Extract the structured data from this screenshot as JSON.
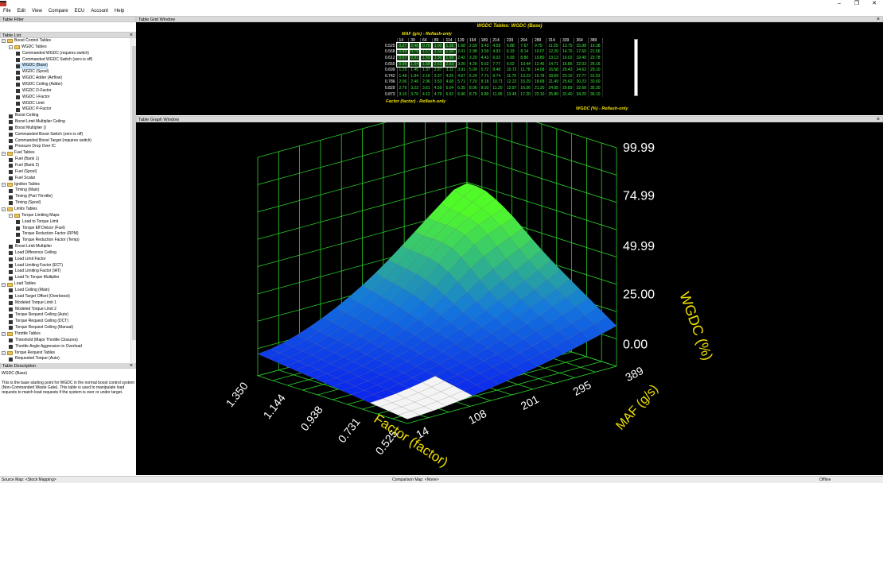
{
  "menu": [
    "File",
    "Edit",
    "View",
    "Compare",
    "ECU",
    "Account",
    "Help"
  ],
  "window_controls": [
    "–",
    "❐",
    "✕"
  ],
  "left": {
    "filter_title": "Table Filter",
    "list_title": "Table List",
    "desc_title": "Table Description",
    "desc_name": "WGDC (Base)",
    "desc_text": "This is the base starting point for WGDC in the normal boost control system (Non-Commanded Waste Gate). This table is used to manipulate load requests to match load requests if the system is over or under target."
  },
  "tree": [
    {
      "label": "Boost Control Tables",
      "level": 0,
      "folder": true
    },
    {
      "label": "WGDC Tables",
      "level": 1,
      "folder": true
    },
    {
      "label": "Commanded WGDC (requires switch)",
      "level": 2
    },
    {
      "label": "Commanded WGDC Switch (zero is off)",
      "level": 2
    },
    {
      "label": "WGDC (Base)",
      "level": 2
    },
    {
      "label": "WGDC (Spool)",
      "level": 2
    },
    {
      "label": "WGDC Adder (Airflow)",
      "level": 2
    },
    {
      "label": "WGDC Ceiling (Adder)",
      "level": 2
    },
    {
      "label": "WGDC D-Factor",
      "level": 2
    },
    {
      "label": "WGDC I-Factor",
      "level": 2
    },
    {
      "label": "WGDC Limit",
      "level": 2
    },
    {
      "label": "WGDC P-Factor",
      "level": 2
    },
    {
      "label": "Boost Ceiling",
      "level": 1
    },
    {
      "label": "Boost Limit Multiplier Ceiling",
      "level": 1
    },
    {
      "label": "Boost Multiplier ()",
      "level": 1
    },
    {
      "label": "Commanded Boost Switch (zero is off)",
      "level": 1
    },
    {
      "label": "Commanded Boost Target (requires switch)",
      "level": 1
    },
    {
      "label": "Pressure Drop Over IC",
      "level": 1
    },
    {
      "label": "Fuel Tables",
      "level": 0,
      "folder": true
    },
    {
      "label": "Fuel (Bank 1)",
      "level": 1
    },
    {
      "label": "Fuel (Bank 2)",
      "level": 1
    },
    {
      "label": "Fuel (Spool)",
      "level": 1
    },
    {
      "label": "Fuel Scalar",
      "level": 1
    },
    {
      "label": "Ignition Tables",
      "level": 0,
      "folder": true
    },
    {
      "label": "Timing (Main)",
      "level": 1
    },
    {
      "label": "Timing (Part Throttle)",
      "level": 1
    },
    {
      "label": "Timing (Spool)",
      "level": 1
    },
    {
      "label": "Limits Tables",
      "level": 0,
      "folder": true
    },
    {
      "label": "Torque Limiting Maps",
      "level": 1,
      "folder": true
    },
    {
      "label": "Load to Torque Limit",
      "level": 2
    },
    {
      "label": "Torque Eff Divisor (Fuel)",
      "level": 2
    },
    {
      "label": "Torque Reduction Factor (RPM)",
      "level": 2
    },
    {
      "label": "Torque Reduction Factor (Temp)",
      "level": 2
    },
    {
      "label": "Boost Limit Multiplier",
      "level": 1
    },
    {
      "label": "Load Difference Ceiling",
      "level": 1
    },
    {
      "label": "Load Limit Factor",
      "level": 1
    },
    {
      "label": "Load Limiting Factor (ECT)",
      "level": 1
    },
    {
      "label": "Load Limiting Factor (IAT)",
      "level": 1
    },
    {
      "label": "Load To Torque Multiplier",
      "level": 1
    },
    {
      "label": "Load Tables",
      "level": 0,
      "folder": true
    },
    {
      "label": "Load Ceiling (Main)",
      "level": 1
    },
    {
      "label": "Load Target Offset (Overboost)",
      "level": 1
    },
    {
      "label": "Modeled Torque Limit 1",
      "level": 1
    },
    {
      "label": "Modeled Torque Limit 2",
      "level": 1
    },
    {
      "label": "Torque Request Ceiling (Auto)",
      "level": 1
    },
    {
      "label": "Torque Request Ceiling (DCT)",
      "level": 1
    },
    {
      "label": "Torque Request Ceiling (Manual)",
      "level": 1
    },
    {
      "label": "Throttle Tables",
      "level": 0,
      "folder": true
    },
    {
      "label": "Threshold (Major Throttle Closures)",
      "level": 1
    },
    {
      "label": "Throttle Angle Aggression in Overload",
      "level": 1
    },
    {
      "label": "Torque Request Tables",
      "level": 0,
      "folder": true
    },
    {
      "label": "Requested Torque (Auto)",
      "level": 1
    }
  ],
  "grid": {
    "window_title": "Table Grid Window",
    "table_title": "WGDC Tables: WGDC (Base)",
    "x_axis_label": "MAF (g/s) - Reflash-only",
    "y_axis_label": "Factor (factor) - Reflash-only",
    "value_label": "WGDC (%) - Reflash-only",
    "columns": [
      "14",
      "39",
      "64",
      "89",
      "114",
      "139",
      "164",
      "189",
      "214",
      "239",
      "264",
      "289",
      "314",
      "339",
      "364",
      "389"
    ],
    "rows": [
      {
        "h": "0.525",
        "v": [
          "0.27",
          "2.48",
          "0.78",
          "1.00",
          "1.38",
          "1.68",
          "2.59",
          "3.43",
          "4.59",
          "5.88",
          "7.67",
          "9.75",
          "11.55",
          "13.75",
          "15.98",
          "19.38"
        ]
      },
      {
        "h": "0.568",
        "v": [
          "0.49",
          "0.79",
          "1.17",
          "1.33",
          "1.54",
          "2.01",
          "2.98",
          "3.59",
          "4.93",
          "6.33",
          "8.14",
          "10.07",
          "12.20",
          "14.76",
          "17.60",
          "21.56"
        ]
      },
      {
        "h": "0.612",
        "v": [
          "0.67",
          "0.91",
          "1.59",
          "1.90",
          "1.98",
          "2.42",
          "3.29",
          "4.43",
          "6.02",
          "6.99",
          "8.80",
          "10.80",
          "13.13",
          "16.02",
          "19.40",
          "23.78"
        ]
      },
      {
        "h": "0.655",
        "v": [
          "0.95",
          "1.34",
          "1.68",
          "2.63",
          "2.53",
          "3.26",
          "4.26",
          "5.62",
          "7.77",
          "9.02",
          "10.44",
          "12.46",
          "14.71",
          "16.86",
          "22.03",
          "26.16"
        ]
      },
      {
        "h": "0.699",
        "v": [
          "1.29",
          "1.46",
          "1.97",
          "2.87",
          "3.11",
          "3.91",
          "5.09",
          "5.72",
          "8.48",
          "10.72",
          "11.78",
          "14.08",
          "16.58",
          "20.43",
          "24.62",
          "29.10"
        ]
      },
      {
        "h": "0.742",
        "v": [
          "1.48",
          "1.84",
          "2.16",
          "3.37",
          "4.25",
          "4.67",
          "6.24",
          "7.71",
          "9.74",
          "11.76",
          "13.23",
          "15.78",
          "18.69",
          "23.10",
          "27.77",
          "31.52"
        ]
      },
      {
        "h": "0.786",
        "v": [
          "2.06",
          "2.46",
          "2.96",
          "3.53",
          "4.68",
          "5.71",
          "7.20",
          "8.18",
          "10.71",
          "12.22",
          "15.29",
          "18.68",
          "21.49",
          "25.62",
          "30.23",
          "33.60"
        ]
      },
      {
        "h": "0.829",
        "v": [
          "2.79",
          "3.23",
          "3.61",
          "4.59",
          "5.04",
          "6.35",
          "8.06",
          "8.93",
          "11.20",
          "12.87",
          "16.56",
          "21.20",
          "24.95",
          "29.89",
          "32.68",
          "35.30"
        ]
      },
      {
        "h": "0.873",
        "v": [
          "3.10",
          "3.70",
          "4.12",
          "4.79",
          "5.52",
          "6.96",
          "8.75",
          "9.80",
          "11.95",
          "13.45",
          "17.20",
          "22.10",
          "25.80",
          "31.40",
          "34.20",
          "36.10"
        ]
      }
    ]
  },
  "graph": {
    "window_title": "Table Graph Window",
    "z_label": "WGDC (%)",
    "x_label": "Factor (factor)",
    "y_label": "MAF (g/s)",
    "z_ticks": [
      "99.99",
      "74.99",
      "49.99",
      "25.00",
      "0.00"
    ],
    "x_ticks": [
      "0.525",
      "0.731",
      "0.938",
      "1.144",
      "1.350"
    ],
    "y_ticks": [
      "389",
      "295",
      "201",
      "108",
      "14"
    ],
    "colors": {
      "grid": "#2bd12b",
      "axis_label": "#f0e000",
      "tick": "#ffffff",
      "surface_low": "#1a1aff",
      "surface_high": "#44ff22"
    }
  },
  "status": {
    "source": "Source Map: <Stock Mapping>",
    "comparison": "Comparison Map: <None>",
    "state": "Offline"
  }
}
